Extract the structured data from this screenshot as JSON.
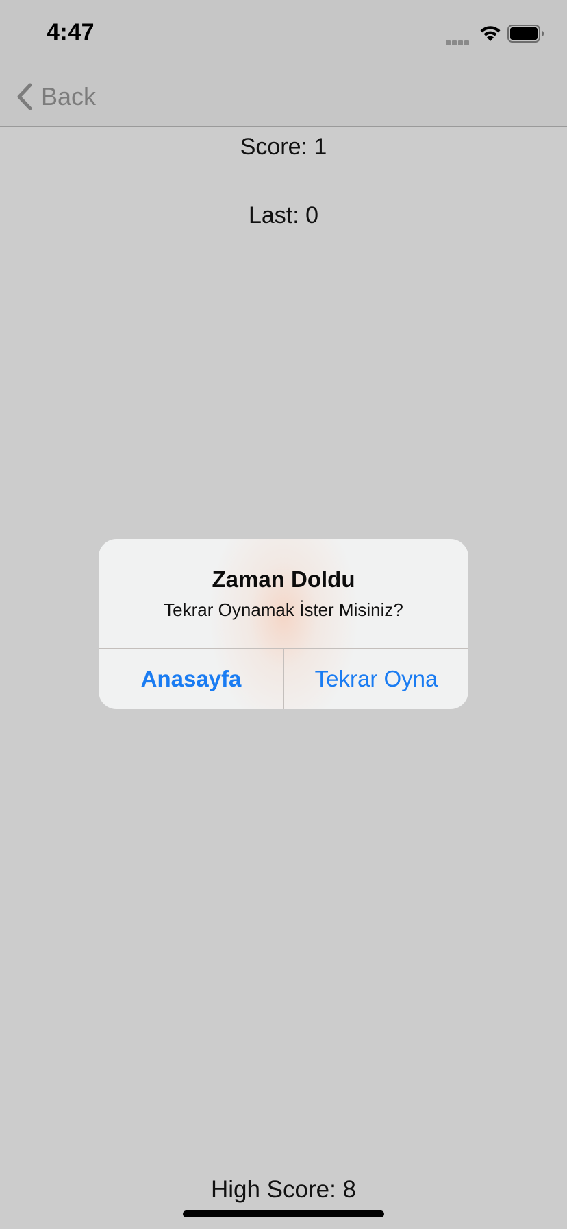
{
  "status_bar": {
    "time": "4:47",
    "icons": [
      "signal-icon",
      "wifi-icon",
      "battery-icon"
    ]
  },
  "nav": {
    "back_label": "Back",
    "back_icon": "chevron-left-icon"
  },
  "game": {
    "score_text": "Score: 1",
    "last_text": "Last: 0",
    "high_score_text": "High Score: 8"
  },
  "alert": {
    "title": "Zaman Doldu",
    "message": "Tekrar Oynamak İster Misiniz?",
    "primary_button": "Anasayfa",
    "secondary_button": "Tekrar Oyna"
  },
  "colors": {
    "background": "#cccccc",
    "bar_background": "#c6c6c6",
    "alert_background": "#f1f2f2",
    "accent": "#1a7cf2",
    "back_text": "#7c7c7c"
  }
}
